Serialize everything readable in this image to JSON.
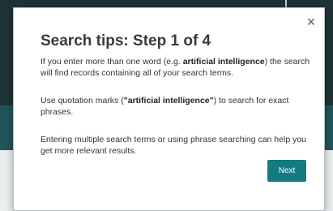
{
  "modal": {
    "close_glyph": "×",
    "title": "Search tips: Step 1 of 4",
    "paragraph1": {
      "before": "If you enter more than one word (e.g. ",
      "bold": "artificial intelligence",
      "after": ") the search will find records containing all of your search terms."
    },
    "paragraph2": {
      "before": "Use quotation marks (",
      "bold": "\"artificial intelligence\"",
      "after": ") to search for exact phrases."
    },
    "paragraph3": "Entering multiple search terms or using phrase searching can help you get more relevant results.",
    "next_label": "Next"
  },
  "colors": {
    "button": "#127c80",
    "background_dark": "#1f3336",
    "background_teal": "#20565a"
  }
}
